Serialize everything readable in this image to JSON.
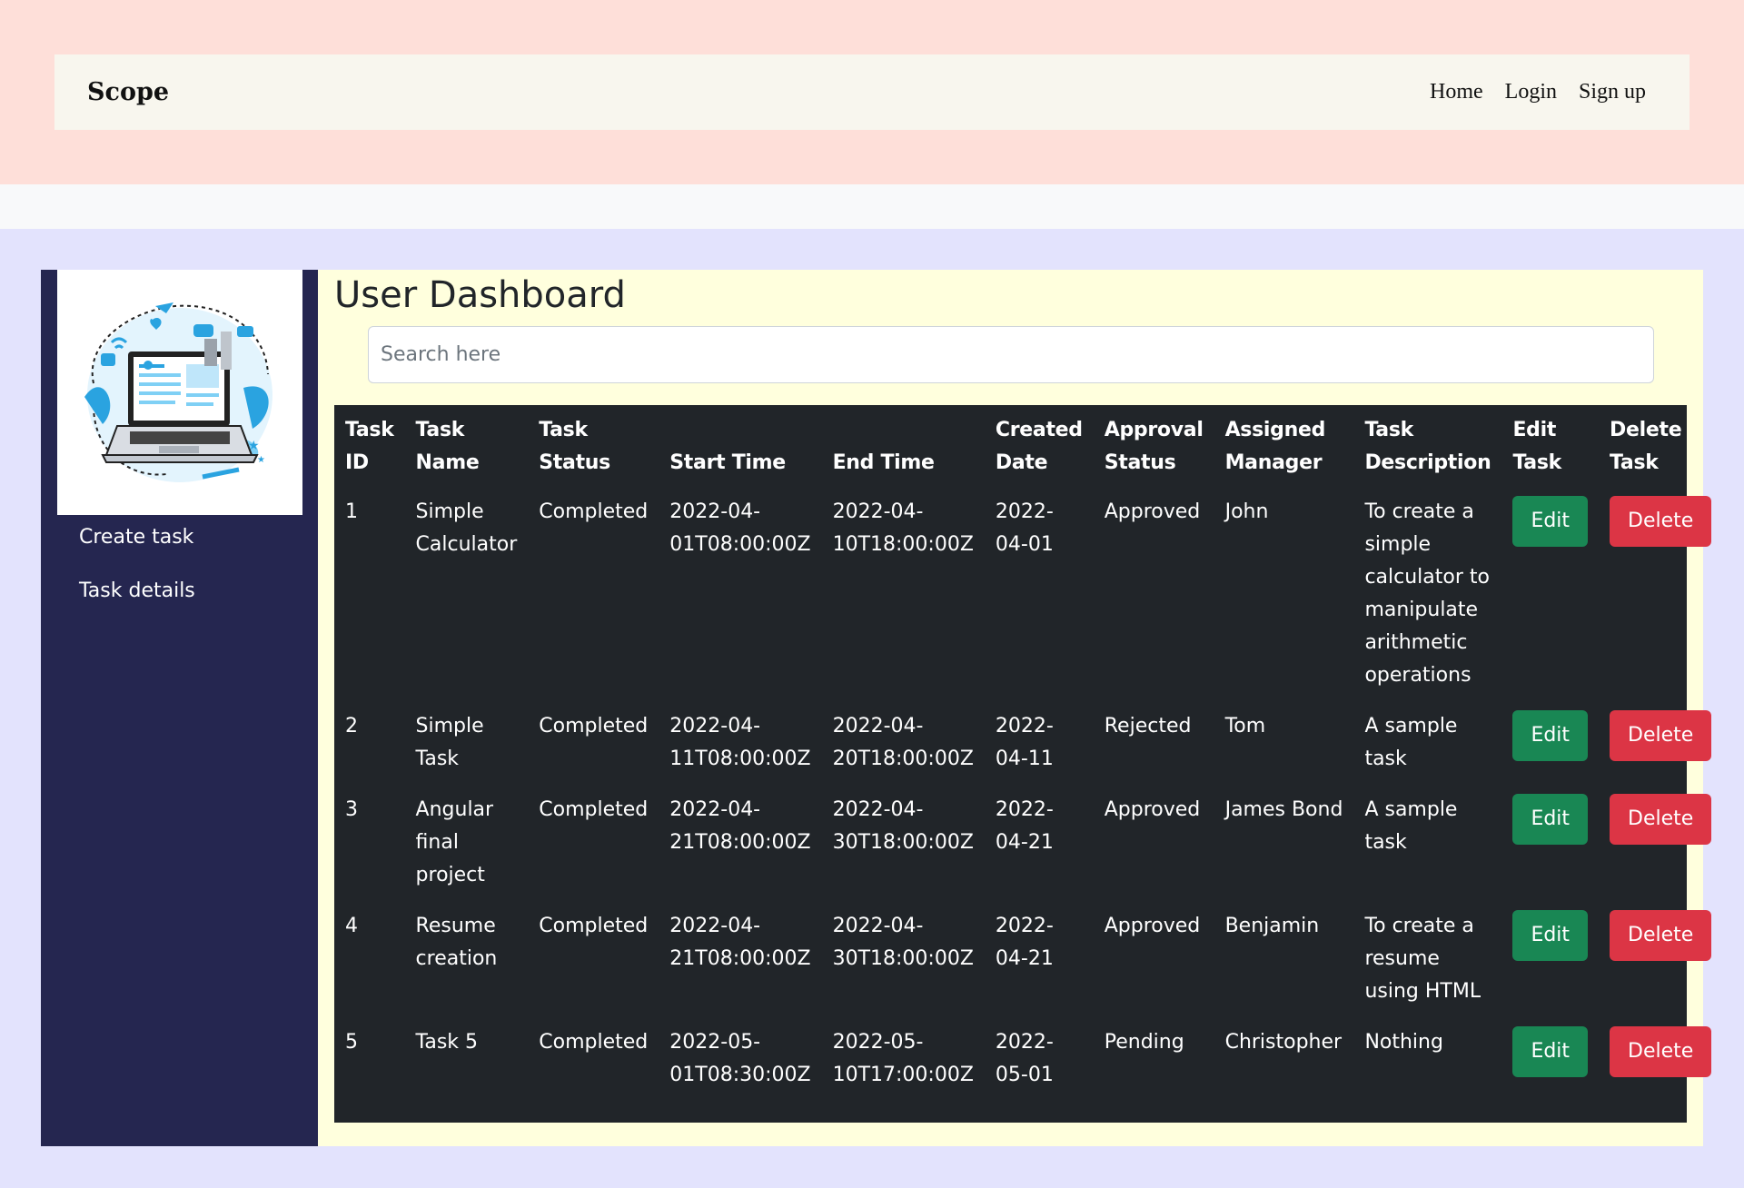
{
  "navbar": {
    "brand": "Scope",
    "links": [
      "Home",
      "Login",
      "Sign up"
    ]
  },
  "sidebar": {
    "logo_icon": "laptop-illustration-icon",
    "items": [
      "Create task",
      "Task details"
    ]
  },
  "main": {
    "title": "User Dashboard",
    "search_placeholder": "Search here"
  },
  "table": {
    "headers": [
      "Task ID",
      "Task Name",
      "Task Status",
      "Start Time",
      "End Time",
      "Created Date",
      "Approval Status",
      "Assigned Manager",
      "Task Description",
      "Edit Task",
      "Delete Task"
    ],
    "rows": [
      [
        "1",
        "Simple Calculator",
        "Completed",
        "2022-04-01T08:00:00Z",
        "2022-04-10T18:00:00Z",
        "2022-04-01",
        "Approved",
        "John",
        "To create a simple calculator to manipulate arithmetic operations"
      ],
      [
        "2",
        "Simple Task",
        "Completed",
        "2022-04-11T08:00:00Z",
        "2022-04-20T18:00:00Z",
        "2022-04-11",
        "Rejected",
        "Tom",
        "A sample task"
      ],
      [
        "3",
        "Angular final project",
        "Completed",
        "2022-04-21T08:00:00Z",
        "2022-04-30T18:00:00Z",
        "2022-04-21",
        "Approved",
        "James Bond",
        "A sample task"
      ],
      [
        "4",
        "Resume creation",
        "Completed",
        "2022-04-21T08:00:00Z",
        "2022-04-30T18:00:00Z",
        "2022-04-21",
        "Approved",
        "Benjamin",
        "To create a resume using HTML"
      ],
      [
        "5",
        "Task 5",
        "Completed",
        "2022-05-01T08:30:00Z",
        "2022-05-10T17:00:00Z",
        "2022-05-01",
        "Pending",
        "Christopher",
        "Nothing"
      ]
    ],
    "edit_label": "Edit",
    "delete_label": "Delete"
  },
  "colors": {
    "top_band": "#fedfd9",
    "navbar": "#f8f6ee",
    "main_band": "#e3e3fd",
    "sidebar": "#252650",
    "content": "#ffffdd",
    "table": "#212529",
    "edit_button": "#198754",
    "delete_button": "#dc3545"
  }
}
